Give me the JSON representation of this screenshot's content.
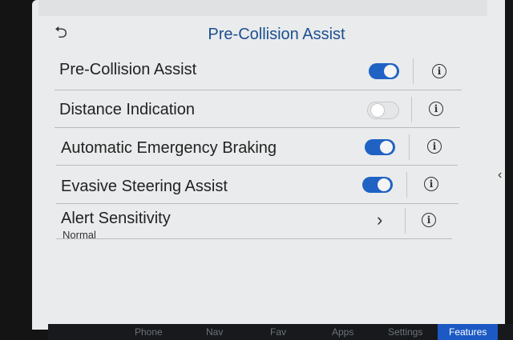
{
  "header": {
    "back_icon": "back-arrow-icon",
    "title": "Pre-Collision Assist"
  },
  "settings": [
    {
      "label": "Pre-Collision Assist",
      "state": "on"
    },
    {
      "label": "Distance Indication",
      "state": "off"
    },
    {
      "label": "Automatic Emergency Braking",
      "state": "on"
    },
    {
      "label": "Evasive Steering Assist",
      "state": "on"
    },
    {
      "label": "Alert Sensitivity",
      "value": "Normal"
    }
  ],
  "nav": {
    "items": [
      "Phone",
      "Nav",
      "Fav",
      "Apps",
      "Settings",
      "Features"
    ],
    "active": "Features"
  },
  "colors": {
    "accent": "#1f62c4",
    "title": "#1d4f91",
    "background": "#e9ebec"
  }
}
